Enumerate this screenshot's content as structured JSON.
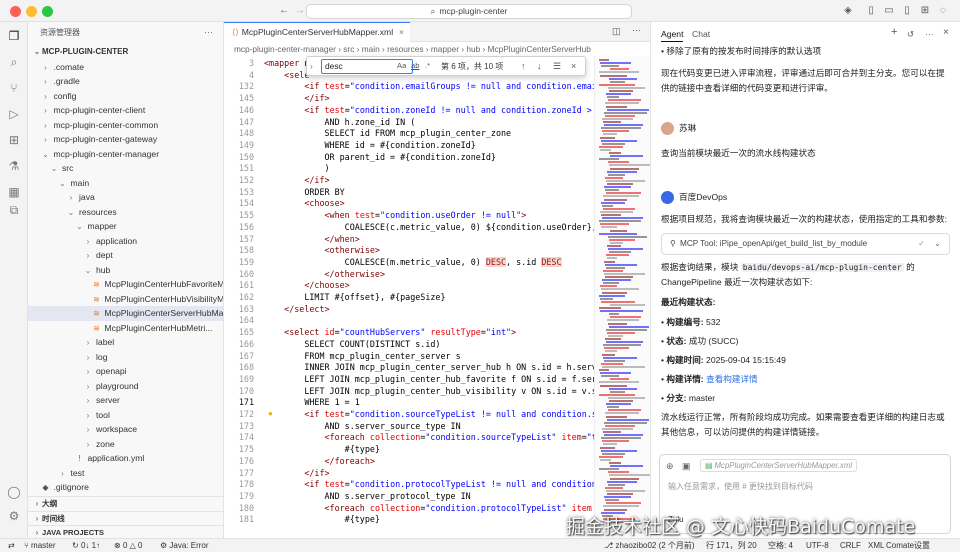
{
  "window": {
    "command_center": "mcp-plugin-center"
  },
  "sidebar": {
    "title": "资源管理器",
    "root": "MCP-PLUGIN-CENTER",
    "tree": [
      {
        "label": ".comate",
        "arrow": "›",
        "indent": 1
      },
      {
        "label": ".gradle",
        "arrow": "›",
        "indent": 1
      },
      {
        "label": "config",
        "arrow": "›",
        "indent": 1
      },
      {
        "label": "mcp-plugin-center-client",
        "arrow": "›",
        "indent": 1
      },
      {
        "label": "mcp-plugin-center-common",
        "arrow": "›",
        "indent": 1
      },
      {
        "label": "mcp-plugin-center-gateway",
        "arrow": "›",
        "indent": 1
      },
      {
        "label": "mcp-plugin-center-manager",
        "arrow": "⌄",
        "indent": 1
      },
      {
        "label": "src",
        "arrow": "⌄",
        "indent": 2
      },
      {
        "label": "main",
        "arrow": "⌄",
        "indent": 3
      },
      {
        "label": "java",
        "arrow": "›",
        "indent": 4
      },
      {
        "label": "resources",
        "arrow": "⌄",
        "indent": 4
      },
      {
        "label": "mapper",
        "arrow": "⌄",
        "indent": 5
      },
      {
        "label": "application",
        "arrow": "›",
        "indent": 6
      },
      {
        "label": "dept",
        "arrow": "›",
        "indent": 6
      },
      {
        "label": "hub",
        "arrow": "⌄",
        "indent": 6
      },
      {
        "label": "McpPluginCenterHubFavoriteMap...",
        "arrow": "",
        "file": true,
        "indent": 7
      },
      {
        "label": "McpPluginCenterHubVisibilityMap...",
        "arrow": "",
        "file": true,
        "indent": 7
      },
      {
        "label": "McpPluginCenterServerHubMapp...",
        "arrow": "",
        "file": true,
        "indent": 7,
        "selected": true
      },
      {
        "label": "McpPluginCenterHubMetri...",
        "arrow": "",
        "file": true,
        "indent": 7
      },
      {
        "label": "label",
        "arrow": "›",
        "indent": 6
      },
      {
        "label": "log",
        "arrow": "›",
        "indent": 6
      },
      {
        "label": "openapi",
        "arrow": "›",
        "indent": 6
      },
      {
        "label": "playground",
        "arrow": "›",
        "indent": 6
      },
      {
        "label": "server",
        "arrow": "›",
        "indent": 6
      },
      {
        "label": "tool",
        "arrow": "›",
        "indent": 6
      },
      {
        "label": "workspace",
        "arrow": "›",
        "indent": 6
      },
      {
        "label": "zone",
        "arrow": "›",
        "indent": 6
      },
      {
        "label": "application.yml",
        "arrow": "",
        "yml": true,
        "indent": 5
      },
      {
        "label": "test",
        "arrow": "›",
        "indent": 3
      },
      {
        "label": ".gitignore",
        "arrow": "",
        "git": true,
        "indent": 1
      }
    ],
    "sections": [
      "大纲",
      "时间线",
      "JAVA PROJECTS"
    ]
  },
  "editor": {
    "tab_label": "McpPluginCenterServerHubMapper.xml",
    "breadcrumbs": "mcp-plugin-center-manager  ›  src  ›  main  ›  resources  ›  mapper  ›  hub  ›  McpPluginCenterServerHub",
    "find": {
      "query": "desc",
      "result": "第 6 项，共 10 项",
      "aa": "Aa",
      "ab": "ab",
      "regex": ".*"
    },
    "lines": [
      {
        "n": "3",
        "html": "<span class='tg'>&lt;mapper</span> n"
      },
      {
        "n": "4",
        "html": "    <span class='tg'>&lt;sele</span>"
      },
      {
        "n": "132",
        "html": "        <span class='tg'>&lt;if</span> <span class='at'>test</span>=<span class='st'>\"condition.emailGroups != null and condition.emailG</span>"
      },
      {
        "n": "145",
        "html": "        <span class='tg'>&lt;/if&gt;</span>"
      },
      {
        "n": "146",
        "html": "        <span class='tg'>&lt;if</span> <span class='at'>test</span>=<span class='st'>\"condition.zoneId != null and condition.zoneId &gt; 0\"</span>"
      },
      {
        "n": "147",
        "html": "            AND h.zone_id IN ("
      },
      {
        "n": "148",
        "html": "            SELECT id FROM mcp_plugin_center_zone"
      },
      {
        "n": "149",
        "html": "            WHERE id = #{condition.zoneId}"
      },
      {
        "n": "150",
        "html": "            OR parent_id = #{condition.zoneId}"
      },
      {
        "n": "151",
        "html": "            )"
      },
      {
        "n": "152",
        "html": "        <span class='tg'>&lt;/if&gt;</span>"
      },
      {
        "n": "153",
        "html": "        ORDER BY"
      },
      {
        "n": "154",
        "html": "        <span class='tg'>&lt;choose&gt;</span>"
      },
      {
        "n": "155",
        "html": "            <span class='tg'>&lt;when</span> <span class='at'>test</span>=<span class='st'>\"condition.useOrder != null\"</span><span class='tg'>&gt;</span>"
      },
      {
        "n": "156",
        "html": "                COALESCE(c.metric_value, 0) ${condition.useOrder}, s"
      },
      {
        "n": "157",
        "html": "            <span class='tg'>&lt;/when&gt;</span>"
      },
      {
        "n": "158",
        "html": "            <span class='tg'>&lt;otherwise&gt;</span>"
      },
      {
        "n": "159",
        "html": "                COALESCE(m.metric_value, 0) <span class='hl'>DESC</span>, s.id <span class='hl'>DESC</span>"
      },
      {
        "n": "160",
        "html": "            <span class='tg'>&lt;/otherwise&gt;</span>"
      },
      {
        "n": "161",
        "html": "        <span class='tg'>&lt;/choose&gt;</span>"
      },
      {
        "n": "162",
        "html": "        LIMIT #{offset}, #{pageSize}"
      },
      {
        "n": "163",
        "html": "    <span class='tg'>&lt;/select&gt;</span>"
      },
      {
        "n": "164",
        "html": ""
      },
      {
        "n": "165",
        "html": "    <span class='tg'>&lt;select</span> <span class='at'>id</span>=<span class='st'>\"countHubServers\"</span> <span class='at'>resultType</span>=<span class='st'>\"int\"</span><span class='tg'>&gt;</span>"
      },
      {
        "n": "166",
        "html": "        SELECT COUNT(DISTINCT s.id)"
      },
      {
        "n": "167",
        "html": "        FROM mcp_plugin_center_server s"
      },
      {
        "n": "168",
        "html": "        INNER JOIN mcp_plugin_center_server_hub h ON s.id = h.server"
      },
      {
        "n": "169",
        "html": "        LEFT JOIN mcp_plugin_center_hub_favorite f ON s.id = f.serve"
      },
      {
        "n": "170",
        "html": "        LEFT JOIN mcp_plugin_center_hub_visibility v ON s.id = v.serv"
      },
      {
        "n": "171",
        "html": "        WHERE 1 = 1",
        "cur": true
      },
      {
        "n": "172",
        "html": "        <span class='tg'>&lt;if</span> <span class='at'>test</span>=<span class='st'>\"condition.sourceTypeList != null and condition.sou</span>"
      },
      {
        "n": "173",
        "html": "            AND s.server_source_type IN"
      },
      {
        "n": "174",
        "html": "            <span class='tg'>&lt;foreach</span> <span class='at'>collection</span>=<span class='st'>\"condition.sourceTypeList\"</span> <span class='at'>item</span>=<span class='st'>\"type</span>"
      },
      {
        "n": "175",
        "html": "                #{type}"
      },
      {
        "n": "176",
        "html": "            <span class='tg'>&lt;/foreach&gt;</span>"
      },
      {
        "n": "177",
        "html": "        <span class='tg'>&lt;/if&gt;</span>"
      },
      {
        "n": "178",
        "html": "        <span class='tg'>&lt;if</span> <span class='at'>test</span>=<span class='st'>\"condition.protocolTypeList != null and condition.p</span>"
      },
      {
        "n": "179",
        "html": "            AND s.server_protocol_type IN"
      },
      {
        "n": "180",
        "html": "            <span class='tg'>&lt;foreach</span> <span class='at'>collection</span>=<span class='st'>\"condition.protocolTypeList\"</span> <span class='at'>item</span>"
      },
      {
        "n": "181",
        "html": "                #{type}"
      }
    ]
  },
  "panel": {
    "tab_agent": "Agent",
    "tab_chat": "Chat",
    "bullet_top": "移除了原有的按发布时间排序的默认选项",
    "para1": "现在代码变更已进入评审流程，评审通过后即可合并到主分支。您可以在提供的链接中查看详细的代码变更和进行评审。",
    "user_name": "苏琳",
    "user_msg": "查询当前模块最近一次的流水线构建状态",
    "bot_name": "百度DevOps",
    "bot_intro": "根据项目规范，我将查询模块最近一次的构建状态，使用指定的工具和参数:",
    "tool_label": "MCP Tool:",
    "tool_name": "iPipe_openApi/get_build_list_by_module",
    "result_pre": "根据查询结果，模块",
    "result_code": "baidu/devops-ai/mcp-plugin-center",
    "result_post": "的 ChangePipeline 最近一次构建状态如下:",
    "heading": "最近构建状态:",
    "items": [
      {
        "k": "构建编号:",
        "v": "532"
      },
      {
        "k": "状态:",
        "v": "成功 (SUCC)"
      },
      {
        "k": "构建时间:",
        "v": "2025-09-04 15:15:49"
      },
      {
        "k": "构建详情:",
        "v": "查看构建详情",
        "link": true
      },
      {
        "k": "分支:",
        "v": "master"
      }
    ],
    "summary": "流水线运行正常，所有阶段均成功完成。如果需要查看更详细的构建日志或其他信息，可以访问提供的构建详情链接。",
    "composer_file": "McpPluginCenterServerHubMapper.xml",
    "composer_placeholder": "输入任意需求，使用 # 更快找到目标代码",
    "mode": "Zulu"
  },
  "status": {
    "branch": "master",
    "sync": "0↓ 1↑",
    "problems": "0",
    "warnings": "0",
    "java": "Java: Error",
    "author": "zhaozibo02 (2 个月前)",
    "pos": "行 171，列 20",
    "spaces": "空格: 4",
    "enc": "UTF-8",
    "eol": "CRLF",
    "lang": "XML",
    "comate": "Comate设置"
  },
  "watermark": "掘金技术社区 @ 文心快码BaiduComate"
}
